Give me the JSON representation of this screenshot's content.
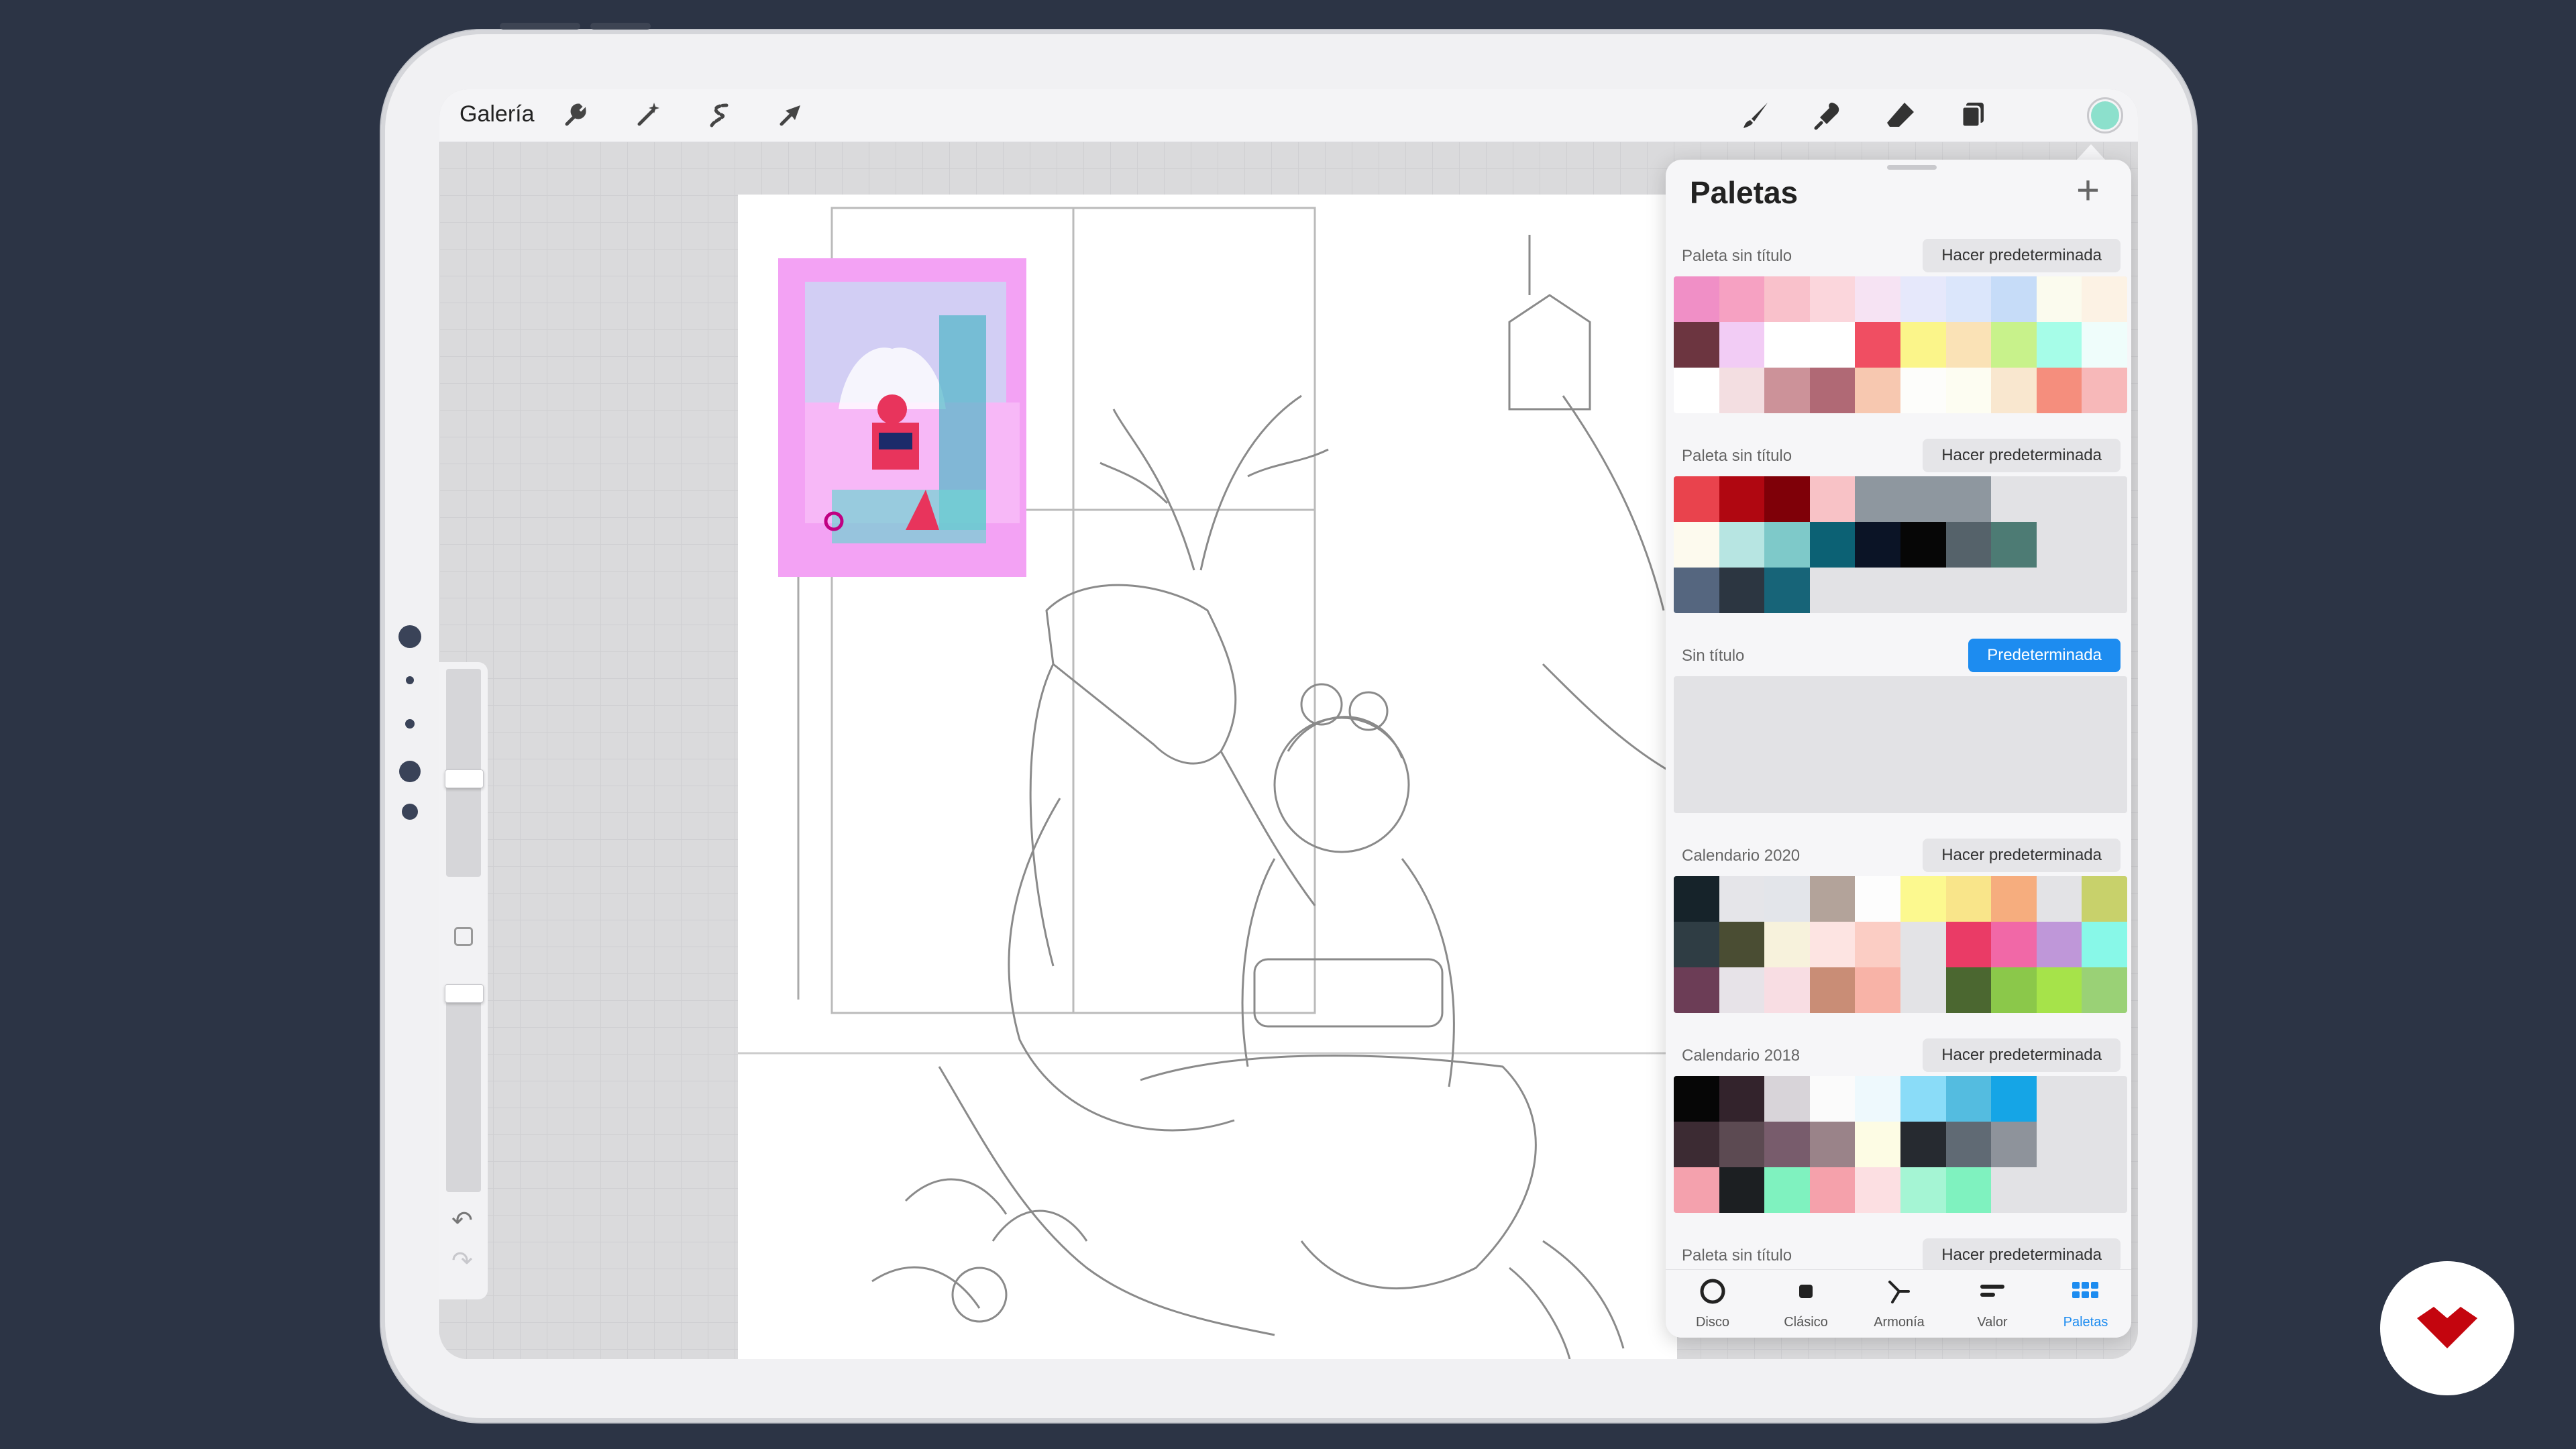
{
  "topbar": {
    "gallery_label": "Galería",
    "left_tools": [
      "wrench-icon",
      "magic-wand-icon",
      "selection-icon",
      "transform-arrow-icon"
    ],
    "right_tools": [
      "brush-icon",
      "smudge-icon",
      "eraser-icon",
      "layers-icon",
      "color-icon"
    ],
    "current_color": "#8ce0cc"
  },
  "sidebar": {
    "undo_icon": "↶",
    "redo_icon": "↷"
  },
  "panel": {
    "title": "Paletas",
    "add_icon": "+",
    "sections": [
      {
        "title": "Paleta sin título",
        "button": "Hacer predeterminada",
        "active": false,
        "swatches": [
          "#f08fc6",
          "#f6a1c2",
          "#f9c1cb",
          "#fbd6dc",
          "#f6e3f3",
          "#e6e8fb",
          "#dbe6fb",
          "#c6dcf8",
          "#fbfbee",
          "#fcf2e4",
          "#6c3540",
          "#f2ccf5",
          "#ffffff",
          "#ffffff",
          "#f04e62",
          "#fbf58a",
          "#fae2b6",
          "#c8f28b",
          "#a6fde8",
          "#effdfb",
          "#ffffff",
          "#f3dee1",
          "#cc9299",
          "#b06975",
          "#f7c8b0",
          "#fdfdfb",
          "#fdfdf2",
          "#f9e7cf",
          "#f58e7d",
          "#f7b8b9"
        ]
      },
      {
        "title": "Paleta sin título",
        "button": "Hacer predeterminada",
        "active": false,
        "swatches": [
          "#e9434d",
          "#b00711",
          "#7f0008",
          "#f8c2c6",
          "#8e979f",
          "#8e979f",
          "#8e979f",
          "",
          "",
          "",
          "#fdfaee",
          "#b7e5e2",
          "#7ec9c9",
          "#0c6174",
          "#0b1426",
          "#060606",
          "#55626a",
          "#4d7b74",
          "",
          "",
          "#55667f",
          "#2c3641",
          "#176478",
          "",
          "",
          "",
          "",
          "",
          "",
          ""
        ]
      },
      {
        "title": "Sin título",
        "button": "Predeterminada",
        "active": true,
        "swatches": []
      },
      {
        "title": "Calendario 2020",
        "button": "Hacer predeterminada",
        "active": false,
        "swatches": [
          "#16232a",
          "#e5e5e9",
          "#e3e5ea",
          "#b3a39a",
          "#fdfdfd",
          "#fcf98f",
          "#f9e58a",
          "#f6ad7e",
          "#e3e3e6",
          "#c8d16b",
          "#2f3d44",
          "#4a4d33",
          "#f7f2dc",
          "#fde4e2",
          "#fbcdc4",
          "#e3e3e6",
          "#ea3b66",
          "#f168a7",
          "#bf97d9",
          "#88f8e8",
          "#6c3d56",
          "#e7e3e8",
          "#f8dde3",
          "#c98d76",
          "#f8b3a7",
          "#e3e3e6",
          "#4b6730",
          "#8bc84a",
          "#a6e34a",
          "#9ad176"
        ]
      },
      {
        "title": "Calendario 2018",
        "button": "Hacer predeterminada",
        "active": false,
        "swatches": [
          "#060606",
          "#33232c",
          "#d8d4d9",
          "#fbfbfb",
          "#eef9fd",
          "#8adcf8",
          "#54bce0",
          "#15a5e6",
          "",
          "",
          "#3c2b33",
          "#5c4a52",
          "#785c6c",
          "#9a8389",
          "#fdfce4",
          "#262a30",
          "#606a74",
          "#8e939b",
          "",
          "",
          "#f4a1ad",
          "#1c1f22",
          "#7ff2bf",
          "#f5a1ab",
          "#fcdfe2",
          "#a5f5d4",
          "#7ff2bf",
          "",
          "",
          ""
        ]
      },
      {
        "title": "Paleta sin título",
        "button": "Hacer predeterminada",
        "active": false,
        "swatches": []
      }
    ],
    "tabs": [
      {
        "label": "Disco",
        "icon": "disc-icon",
        "active": false
      },
      {
        "label": "Clásico",
        "icon": "classic-icon",
        "active": false
      },
      {
        "label": "Armonía",
        "icon": "harmony-icon",
        "active": false
      },
      {
        "label": "Valor",
        "icon": "value-icon",
        "active": false
      },
      {
        "label": "Paletas",
        "icon": "palettes-icon",
        "active": true
      }
    ]
  },
  "logo": {
    "color": "#c4050e"
  }
}
